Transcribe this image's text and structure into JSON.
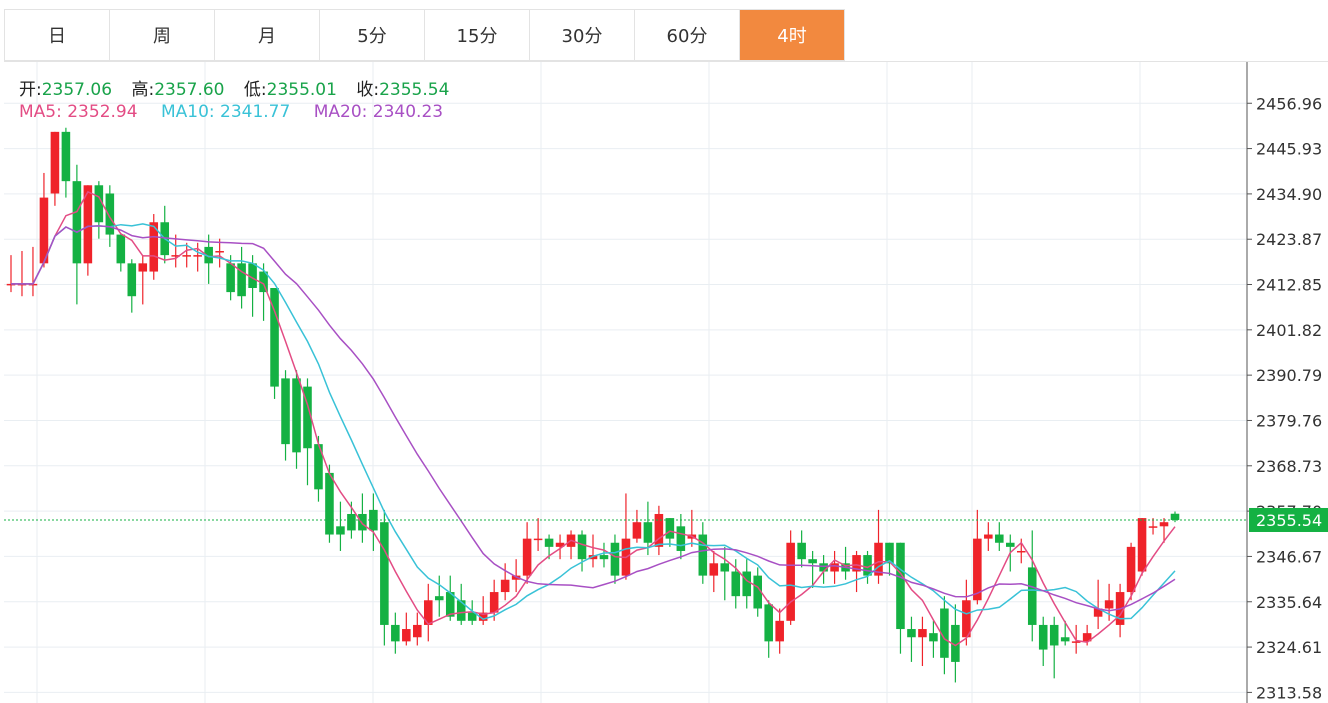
{
  "periods": [
    "日",
    "周",
    "月",
    "5分",
    "15分",
    "30分",
    "60分",
    "4时"
  ],
  "active_period": "4时",
  "ohlc": {
    "open_label": "开:",
    "open": "2357.06",
    "high_label": "高:",
    "high": "2357.60",
    "low_label": "低:",
    "low": "2355.01",
    "close_label": "收:",
    "close": "2355.54"
  },
  "ma_labels": {
    "ma5": "MA5: 2352.94",
    "ma10": "MA10: 2341.77",
    "ma20": "MA20: 2340.23"
  },
  "colors": {
    "up": "#ef232a",
    "down": "#14b143",
    "ma5": "#e34c84",
    "ma10": "#39c2d7",
    "ma20": "#a850c4",
    "accent": "#f2893f",
    "last_price_bg": "#14b143"
  },
  "chart_data": {
    "type": "candlestick",
    "y_ticks": [
      "2456.96",
      "2445.93",
      "2434.90",
      "2423.87",
      "2412.85",
      "2401.82",
      "2390.79",
      "2379.76",
      "2368.73",
      "2357.70",
      "2346.67",
      "2335.64",
      "2324.61",
      "2313.58"
    ],
    "ylim": [
      2311.0,
      2467.0
    ],
    "last_price": "2355.54",
    "candles": [
      [
        2413,
        2413,
        2420,
        2411
      ],
      [
        2413,
        2413,
        2421,
        2410
      ],
      [
        2413,
        2413,
        2422,
        2410
      ],
      [
        2418,
        2434,
        2440,
        2417
      ],
      [
        2435,
        2450,
        2450,
        2432
      ],
      [
        2450,
        2438,
        2451,
        2434
      ],
      [
        2438,
        2418,
        2442,
        2408
      ],
      [
        2418,
        2437,
        2437,
        2415
      ],
      [
        2437,
        2428,
        2438,
        2424
      ],
      [
        2435,
        2425,
        2437,
        2422
      ],
      [
        2425,
        2418,
        2425,
        2416
      ],
      [
        2418,
        2410,
        2419,
        2406
      ],
      [
        2416,
        2418,
        2420,
        2408
      ],
      [
        2416,
        2428,
        2430,
        2414
      ],
      [
        2428,
        2420,
        2432
      ],
      [
        2420,
        2420,
        2425,
        2417
      ],
      [
        2420,
        2420,
        2423,
        2417
      ],
      [
        2420,
        2420,
        2423,
        2416
      ],
      [
        2422,
        2418,
        2425,
        2413
      ],
      [
        2421,
        2421,
        2424,
        2417
      ],
      [
        2418,
        2411,
        2420,
        2409
      ],
      [
        2418,
        2410,
        2422,
        2407
      ],
      [
        2418,
        2412,
        2420,
        2405
      ],
      [
        2416,
        2411,
        2418,
        2404
      ],
      [
        2412,
        2388,
        2412,
        2385
      ],
      [
        2390,
        2374,
        2392,
        2370
      ],
      [
        2390,
        2372,
        2392,
        2368
      ],
      [
        2388,
        2373,
        2390,
        2364
      ],
      [
        2374,
        2363,
        2376,
        2360
      ],
      [
        2367,
        2352,
        2369,
        2350
      ],
      [
        2354,
        2352,
        2360,
        2348
      ],
      [
        2357,
        2353,
        2360,
        2351
      ],
      [
        2357,
        2353,
        2362,
        2350
      ],
      [
        2358,
        2353,
        2362,
        2348
      ],
      [
        2355,
        2330,
        2358,
        2325
      ],
      [
        2330,
        2326,
        2333,
        2323
      ],
      [
        2326,
        2329,
        2333,
        2325
      ],
      [
        2327,
        2330,
        2333,
        2325
      ],
      [
        2330,
        2336,
        2340,
        2326
      ],
      [
        2337,
        2336,
        2342,
        2332
      ],
      [
        2338,
        2332,
        2342,
        2331
      ],
      [
        2336,
        2331,
        2340,
        2330
      ],
      [
        2333,
        2331,
        2336,
        2330
      ],
      [
        2331,
        2333,
        2337,
        2330
      ],
      [
        2333,
        2338,
        2341,
        2331
      ],
      [
        2338,
        2341,
        2345,
        2336
      ],
      [
        2341,
        2342,
        2346,
        2338
      ],
      [
        2342,
        2351,
        2355,
        2340
      ],
      [
        2351,
        2351,
        2356,
        2348
      ],
      [
        2351,
        2349,
        2352,
        2346
      ],
      [
        2349,
        2350,
        2352,
        2346
      ],
      [
        2349,
        2352,
        2353,
        2346
      ],
      [
        2352,
        2346,
        2353,
        2343
      ],
      [
        2346,
        2347,
        2352,
        2344
      ],
      [
        2347,
        2346,
        2350,
        2344
      ],
      [
        2350,
        2342,
        2352,
        2340
      ],
      [
        2342,
        2351,
        2362,
        2341
      ],
      [
        2351,
        2355,
        2358,
        2350
      ],
      [
        2355,
        2350,
        2360,
        2347
      ],
      [
        2349,
        2357,
        2359,
        2347
      ],
      [
        2356,
        2351,
        2356,
        2349
      ],
      [
        2354,
        2348,
        2357,
        2346
      ],
      [
        2351,
        2352,
        2358,
        2349
      ],
      [
        2352,
        2342,
        2355,
        2340
      ],
      [
        2342,
        2345,
        2348,
        2338
      ],
      [
        2345,
        2343,
        2349,
        2336
      ],
      [
        2343,
        2337,
        2346,
        2334
      ],
      [
        2343,
        2337,
        2346,
        2334
      ],
      [
        2342,
        2334,
        2344,
        2332
      ],
      [
        2335,
        2326,
        2336,
        2322
      ],
      [
        2326,
        2331,
        2334,
        2323
      ],
      [
        2331,
        2350,
        2353,
        2330
      ],
      [
        2350,
        2346,
        2353,
        2344
      ],
      [
        2346,
        2345,
        2348,
        2339
      ],
      [
        2345,
        2343,
        2347,
        2340
      ],
      [
        2343,
        2345,
        2348,
        2340
      ],
      [
        2345,
        2343,
        2349,
        2341
      ],
      [
        2343,
        2347,
        2348,
        2338
      ],
      [
        2347,
        2342,
        2348,
        2340
      ],
      [
        2342,
        2350,
        2358,
        2340
      ],
      [
        2350,
        2345,
        2350,
        2342
      ],
      [
        2350,
        2329,
        2350,
        2323
      ],
      [
        2329,
        2327,
        2332,
        2321
      ],
      [
        2327,
        2329,
        2332,
        2320
      ],
      [
        2328,
        2326,
        2331,
        2322
      ],
      [
        2334,
        2322,
        2337,
        2318
      ],
      [
        2330,
        2321,
        2335,
        2316
      ],
      [
        2327,
        2336,
        2341,
        2325
      ],
      [
        2336,
        2351,
        2358,
        2335
      ],
      [
        2351,
        2352,
        2355,
        2348
      ],
      [
        2352,
        2350,
        2355,
        2348
      ],
      [
        2350,
        2349,
        2352,
        2343
      ],
      [
        2348,
        2348,
        2351,
        2345
      ],
      [
        2344,
        2330,
        2353,
        2326
      ],
      [
        2330,
        2324,
        2332,
        2320
      ],
      [
        2330,
        2325,
        2332,
        2317
      ],
      [
        2327,
        2326,
        2331,
        2325
      ],
      [
        2326,
        2326,
        2330,
        2323
      ],
      [
        2326,
        2328,
        2330,
        2325
      ],
      [
        2332,
        2334,
        2341,
        2329
      ],
      [
        2334,
        2336,
        2340,
        2331
      ],
      [
        2330,
        2338,
        2340,
        2327
      ],
      [
        2338,
        2349,
        2350,
        2336
      ],
      [
        2343,
        2356,
        2356,
        2342
      ],
      [
        2354,
        2354,
        2356,
        2352
      ],
      [
        2354,
        2355,
        2356,
        2350
      ],
      [
        2357.06,
        2355.54,
        2357.6,
        2355.01
      ]
    ]
  }
}
